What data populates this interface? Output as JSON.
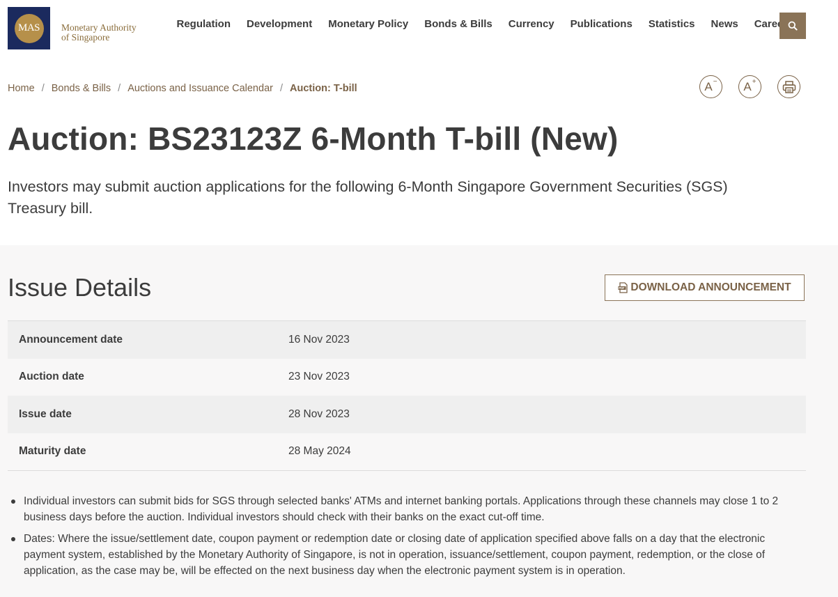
{
  "brand": {
    "logo_mark": "MAS",
    "name_line1": "Monetary Authority",
    "name_line2": "of Singapore",
    "navy": "#1b2a5e",
    "gold": "#b6904a",
    "accent": "#8a7357"
  },
  "nav": {
    "items": [
      "Regulation",
      "Development",
      "Monetary Policy",
      "Bonds & Bills",
      "Currency",
      "Publications",
      "Statistics",
      "News",
      "Careers"
    ],
    "search_icon": "search-icon"
  },
  "breadcrumb": {
    "items": [
      "Home",
      "Bonds & Bills",
      "Auctions and Issuance Calendar"
    ],
    "current": "Auction: T-bill",
    "separator": "/"
  },
  "tools": {
    "decrease_font": "A",
    "increase_font": "A",
    "decrease_sign": "−",
    "increase_sign": "+",
    "print_icon": "printer-icon"
  },
  "page": {
    "title": "Auction: BS23123Z 6-Month T-bill (New)",
    "intro": "Investors may submit auction applications for the following 6-Month Singapore Government Securities (SGS) Treasury bill."
  },
  "issue_details": {
    "heading": "Issue Details",
    "download_label": "DOWNLOAD ANNOUNCEMENT",
    "download_icon": "pdf-icon",
    "rows": [
      {
        "label": "Announcement date",
        "value": "16 Nov 2023"
      },
      {
        "label": "Auction date",
        "value": "23 Nov 2023"
      },
      {
        "label": "Issue date",
        "value": "28 Nov 2023"
      },
      {
        "label": "Maturity date",
        "value": "28 May 2024"
      }
    ],
    "notes": [
      "Individual investors can submit bids for SGS through selected banks' ATMs and internet banking portals. Applications through these channels may close 1 to 2 business days before the auction. Individual investors should check with their banks on the exact cut-off time.",
      "Dates: Where the issue/settlement date, coupon payment or redemption date or closing date of application specified above falls on a day that the electronic payment system, established by the Monetary Authority of Singapore, is not in operation, issuance/settlement, coupon payment, redemption, or the close of application, as the case may be, will be effected on the next business day when the electronic payment system is in operation."
    ]
  }
}
